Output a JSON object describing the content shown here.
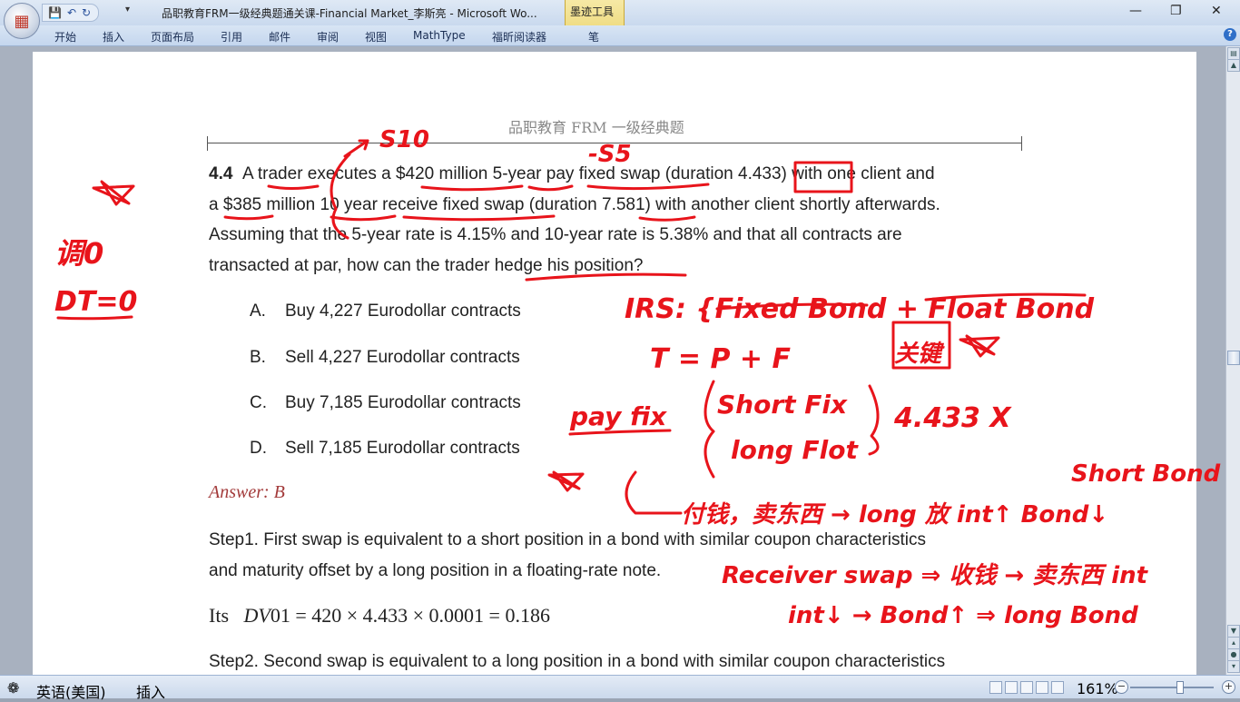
{
  "window": {
    "title": "品职教育FRM一级经典题通关课-Financial Market_李斯亮 - Microsoft Wo...",
    "contextual_tab": "墨迹工具",
    "min": "—",
    "max": "❐",
    "close": "✕"
  },
  "ribbon": {
    "tabs": [
      "开始",
      "插入",
      "页面布局",
      "引用",
      "邮件",
      "审阅",
      "视图",
      "MathType",
      "福昕阅读器",
      "笔"
    ]
  },
  "page": {
    "header": "品职教育    FRM  一级经典题",
    "question": {
      "number": "4.4",
      "line1": "A trader executes a $420 million 5-year pay fixed swap (duration 4.433) with one client and",
      "line2": "a $385 million 10 year receive fixed swap (duration 7.581) with another client shortly afterwards.",
      "line3": "Assuming that the 5-year rate is 4.15% and 10-year rate is 5.38% and that all contracts are",
      "line4": "transacted at par, how can the trader hedge his position?"
    },
    "options": [
      {
        "letter": "A.",
        "text": "Buy 4,227 Eurodollar contracts"
      },
      {
        "letter": "B.",
        "text": "Sell 4,227 Eurodollar contracts"
      },
      {
        "letter": "C.",
        "text": "Buy 7,185 Eurodollar contracts"
      },
      {
        "letter": "D.",
        "text": "Sell 7,185 Eurodollar contracts"
      }
    ],
    "answer": "Answer: B",
    "step1_line1": "Step1. First swap is equivalent to a short position in a bond with similar coupon characteristics",
    "step1_line2": "and maturity offset by a long position in a floating-rate note.",
    "formula_its": "Its",
    "formula_dv": "DV",
    "formula_rest": "01 = 420 × 4.433 × 0.0001 = 0.186",
    "step2_line1": "Step2. Second swap is equivalent to a long position in a bond with similar coupon characteristics"
  },
  "ink_notes": {
    "s10": "S10",
    "s5": "-S5",
    "tiao0": "调0",
    "dt0": "DT=0",
    "irs": "IRS: {Fixed Bond + Float Bond",
    "tpf": "T = P + F",
    "pay_fix": "pay fix",
    "short_fix": "Short Fix",
    "long_flot": "long Flot",
    "dur": "4.433 X",
    "pay_fixed_note": "付钱，卖东西 → long 放 int↑ Bond↓",
    "short_bond": "Short Bond",
    "receiver_swap": "Receiver swap ⇒ 收钱 → 卖东西 int",
    "int_down": "int↓ → Bond↑ ⇒ long Bond",
    "guanjian": "关键"
  },
  "status": {
    "language": "英语(美国)",
    "insert": "插入",
    "zoom": "161%"
  },
  "colors": {
    "ink": "#e8141b",
    "answer": "#a33b3b"
  }
}
